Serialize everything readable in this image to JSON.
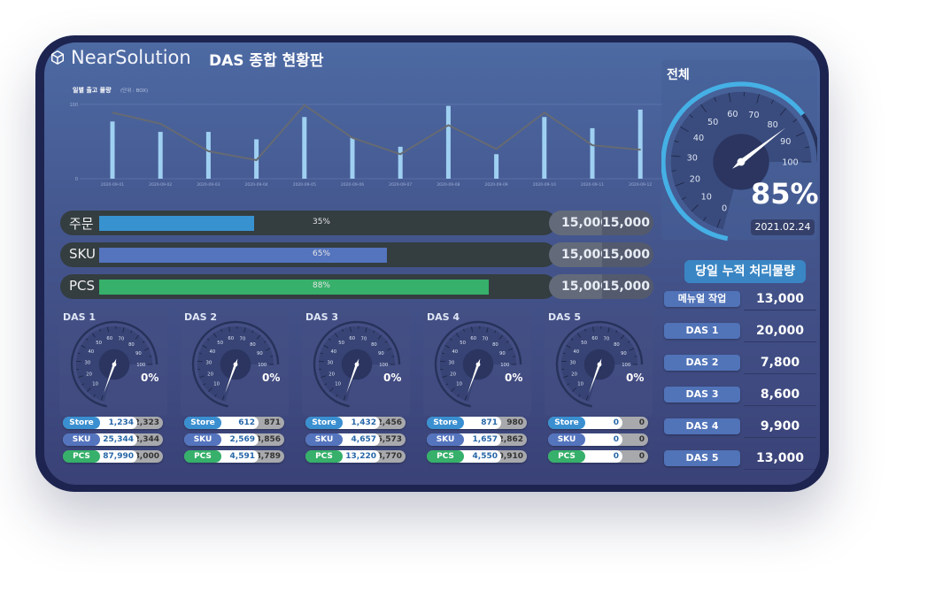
{
  "header": {
    "brand": "NearSolution",
    "title": "DAS 종합 현황판"
  },
  "chart_data": {
    "type": "bar",
    "title": "일별 출고 물량",
    "unit": "(단위 : BOX)",
    "categories": [
      "2020-09-01",
      "2020-09-02",
      "2020-09-03",
      "2020-09-04",
      "2020-09-05",
      "2020-09-06",
      "2020-09-07",
      "2020-09-08",
      "2020-09-09",
      "2020-09-10",
      "2020-09-11",
      "2020-09-12"
    ],
    "series": [
      {
        "name": "bar",
        "type": "bar",
        "color": "#9fd0f2",
        "values": [
          77,
          63,
          63,
          53,
          83,
          55,
          43,
          98,
          33,
          83,
          68,
          93
        ]
      },
      {
        "name": "line",
        "type": "line",
        "color": "#666a72",
        "values": [
          89,
          74,
          37,
          25,
          99,
          55,
          33,
          72,
          40,
          89,
          45,
          39
        ]
      }
    ],
    "ylim": [
      0,
      100
    ],
    "yticks": [
      "0",
      "100"
    ],
    "grid": true
  },
  "progress": [
    {
      "label": "주문",
      "percent": 35,
      "pct_text": "35%",
      "color": "#3892d0",
      "value1": "15,000",
      "value2": "15,000"
    },
    {
      "label": "SKU",
      "percent": 65,
      "pct_text": "65%",
      "color": "#5474be",
      "value1": "15,000",
      "value2": "15,000"
    },
    {
      "label": "PCS",
      "percent": 88,
      "pct_text": "88%",
      "color": "#36b06a",
      "value1": "15,000",
      "value2": "15,000"
    }
  ],
  "gauge_scale": [
    "0",
    "10",
    "20",
    "30",
    "40",
    "50",
    "60",
    "70",
    "80",
    "90",
    "100"
  ],
  "das": [
    {
      "name": "DAS 1",
      "value": 0,
      "pct": "0%",
      "rows": [
        [
          "Store",
          "1,234",
          "2,323"
        ],
        [
          "SKU",
          "25,344",
          "32,344"
        ],
        [
          "PCS",
          "87,990",
          "98,000"
        ]
      ]
    },
    {
      "name": "DAS 2",
      "value": 0,
      "pct": "0%",
      "rows": [
        [
          "Store",
          "612",
          "871"
        ],
        [
          "SKU",
          "2,569",
          "3,856"
        ],
        [
          "PCS",
          "4,591",
          "8,789"
        ]
      ]
    },
    {
      "name": "DAS 3",
      "value": 0,
      "pct": "0%",
      "rows": [
        [
          "Store",
          "1,432",
          "2,456"
        ],
        [
          "SKU",
          "4,657",
          "6,573"
        ],
        [
          "PCS",
          "13,220",
          "28,770"
        ]
      ]
    },
    {
      "name": "DAS 4",
      "value": 0,
      "pct": "0%",
      "rows": [
        [
          "Store",
          "871",
          "980"
        ],
        [
          "SKU",
          "1,657",
          "2,862"
        ],
        [
          "PCS",
          "4,550",
          "10,910"
        ]
      ]
    },
    {
      "name": "DAS 5",
      "value": 0,
      "pct": "0%",
      "rows": [
        [
          "Store",
          "0",
          "0"
        ],
        [
          "SKU",
          "0",
          "0"
        ],
        [
          "PCS",
          "0",
          "0"
        ]
      ]
    }
  ],
  "pill_colors": {
    "Store": "#3a8fd0",
    "SKU": "#5474be",
    "PCS": "#36b06a"
  },
  "total": {
    "title": "전체",
    "value": 85,
    "pct": "85%",
    "date": "2021.02.24",
    "accent": "#45b0e5"
  },
  "accum": {
    "title": "당일 누적 처리물량",
    "rows": [
      {
        "label": "메뉴얼 작업",
        "value": "13,000"
      },
      {
        "label": "DAS 1",
        "value": "20,000"
      },
      {
        "label": "DAS 2",
        "value": "7,800"
      },
      {
        "label": "DAS 3",
        "value": "8,600"
      },
      {
        "label": "DAS 4",
        "value": "9,900"
      },
      {
        "label": "DAS 5",
        "value": "13,000"
      }
    ]
  }
}
